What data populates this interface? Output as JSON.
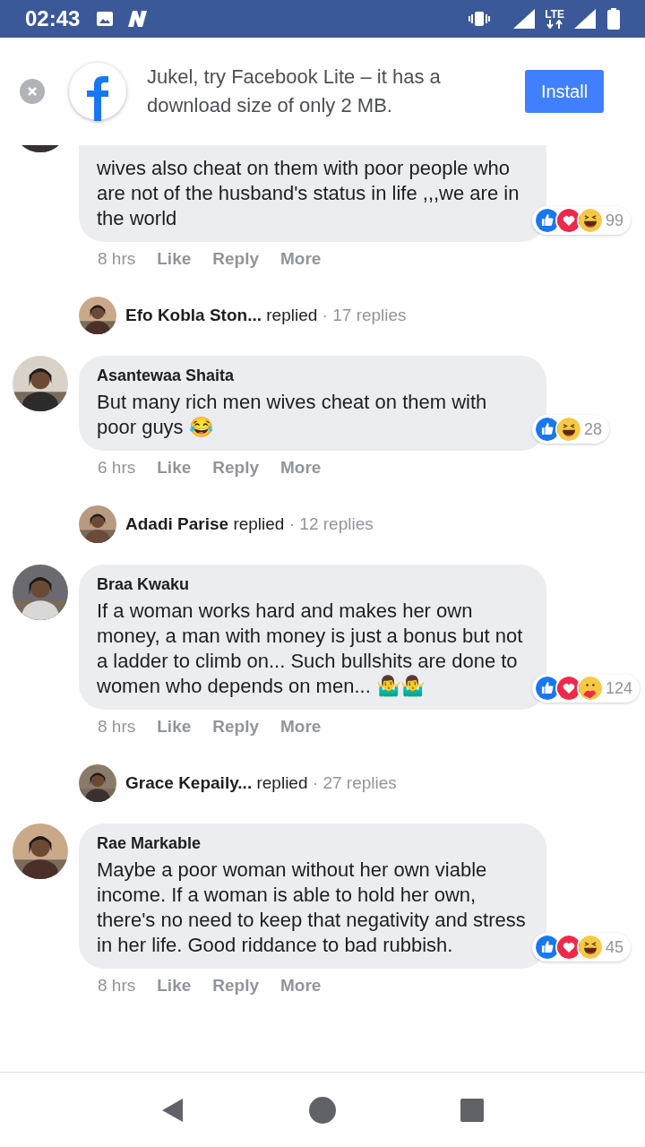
{
  "status_bar": {
    "time": "02:43",
    "network": "LTE"
  },
  "banner": {
    "message": "Jukel, try Facebook Lite – it has a download size of only 2 MB.",
    "button": "Install"
  },
  "feed": [
    {
      "kind": "comment",
      "cut_top": true,
      "text": "wives also cheat on them with poor people who are not of the husband's status in life ,,,we are in the world",
      "time": "8 hrs",
      "actions": [
        "Like",
        "Reply",
        "More"
      ],
      "reactions": [
        {
          "kind": "like"
        },
        {
          "kind": "love"
        },
        {
          "kind": "haha"
        }
      ],
      "reaction_count": "99"
    },
    {
      "kind": "replies",
      "name": "Efo Kobla Ston...",
      "verb": "replied",
      "count": "· 17 replies"
    },
    {
      "kind": "comment",
      "cut_top": false,
      "author": "Asantewaa Shaita",
      "text": "But many rich men wives cheat on them with poor guys 😂",
      "time": "6 hrs",
      "actions": [
        "Like",
        "Reply",
        "More"
      ],
      "reactions": [
        {
          "kind": "like"
        },
        {
          "kind": "haha"
        }
      ],
      "reaction_count": "28"
    },
    {
      "kind": "replies",
      "name": "Adadi Parise",
      "verb": "replied",
      "count": "· 12 replies"
    },
    {
      "kind": "comment",
      "cut_top": false,
      "author": "Braa Kwaku",
      "text": "If a woman works hard and makes her own money, a man with money is just a bonus but not a ladder to climb on... Such bullshits are done to women who depends on men... 🤷‍♂️🤷‍♂️",
      "time": "8 hrs",
      "actions": [
        "Like",
        "Reply",
        "More"
      ],
      "reactions": [
        {
          "kind": "like"
        },
        {
          "kind": "love"
        },
        {
          "kind": "care"
        }
      ],
      "reaction_count": "124"
    },
    {
      "kind": "replies",
      "name": "Grace Kepaily...",
      "verb": "replied",
      "count": "· 27 replies"
    },
    {
      "kind": "comment",
      "cut_top": false,
      "author": "Rae Markable",
      "text": "Maybe a poor woman without her own viable income. If a woman is able to hold her own, there's no need to keep that negativity and stress in her life. Good riddance to bad rubbish.",
      "time": "8 hrs",
      "actions": [
        "Like",
        "Reply",
        "More"
      ],
      "reactions": [
        {
          "kind": "like"
        },
        {
          "kind": "love"
        },
        {
          "kind": "haha"
        }
      ],
      "reaction_count": "45"
    }
  ]
}
